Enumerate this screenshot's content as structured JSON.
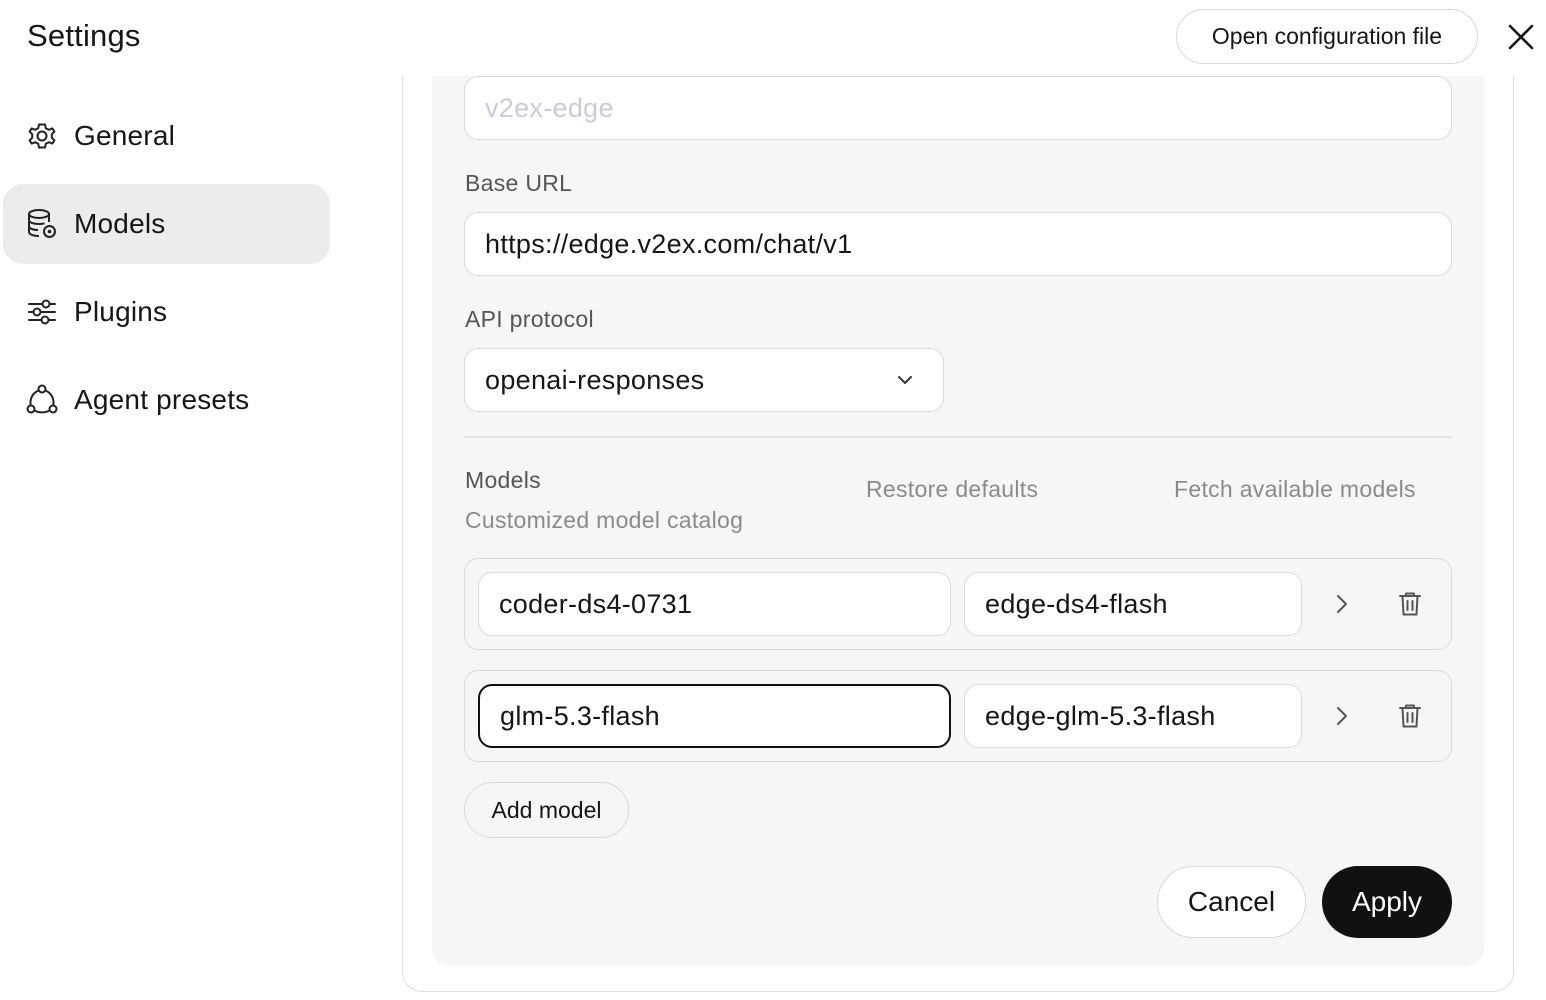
{
  "header": {
    "title": "Settings",
    "open_config_label": "Open configuration file",
    "close_icon": "close-icon"
  },
  "sidebar": {
    "items": [
      {
        "label": "General",
        "icon": "gear-icon",
        "active": false
      },
      {
        "label": "Models",
        "icon": "database-gear-icon",
        "active": true
      },
      {
        "label": "Plugins",
        "icon": "sliders-icon",
        "active": false
      },
      {
        "label": "Agent presets",
        "icon": "nodes-icon",
        "active": false
      }
    ]
  },
  "form": {
    "name_placeholder": "v2ex-edge",
    "base_url_label": "Base URL",
    "base_url_value": "https://edge.v2ex.com/chat/v1",
    "api_protocol_label": "API protocol",
    "api_protocol_value": "openai-responses"
  },
  "models_section": {
    "title": "Models",
    "subtitle": "Customized model catalog",
    "restore_label": "Restore defaults",
    "fetch_label": "Fetch available models",
    "rows": [
      {
        "model_id": "coder-ds4-0731",
        "alias": "edge-ds4-flash"
      },
      {
        "model_id": "glm-5.3-flash",
        "alias": "edge-glm-5.3-flash"
      }
    ],
    "add_label": "Add model"
  },
  "footer": {
    "cancel_label": "Cancel",
    "apply_label": "Apply"
  },
  "colors": {
    "accent": "#111111",
    "active_nav_bg": "#ececef",
    "panel_bg": "#f6f6f7",
    "muted_text": "#8a8a8e"
  }
}
